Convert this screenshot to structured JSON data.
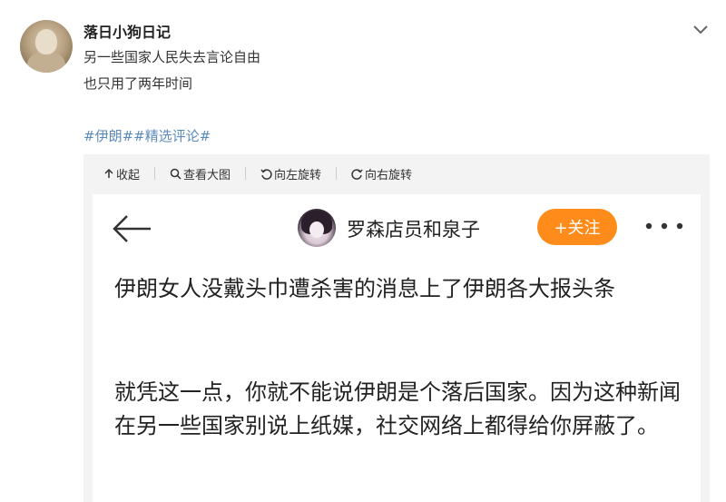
{
  "post": {
    "username": "落日小狗日记",
    "lines": [
      "另一些国家人民失去言论自由",
      "也只用了两年时间"
    ],
    "hashtags": [
      "#伊朗#",
      "#精选评论#"
    ]
  },
  "viewer_toolbar": {
    "collapse_label": "收起",
    "view_large_label": "查看大图",
    "rotate_left_label": "向左旋转",
    "rotate_right_label": "向右旋转"
  },
  "screenshot": {
    "account_name": "罗森店员和泉子",
    "follow_label": "+关注",
    "paragraphs": [
      "伊朗女人没戴头巾遭杀害的消息上了伊朗各大报头条",
      "就凭这一点，你就不能说伊朗是个落后国家。因为这种新闻在另一些国家别说上纸媒，社交网络上都得给你屏蔽了。"
    ]
  },
  "colors": {
    "hashtag": "#5b8ab8",
    "follow_button": "#ff8c1a",
    "viewer_bg": "#f3f3f3"
  },
  "icons": [
    "chevron-down-icon",
    "collapse-icon",
    "magnify-icon",
    "rotate-left-icon",
    "rotate-right-icon",
    "back-arrow-icon",
    "more-dots-icon"
  ]
}
